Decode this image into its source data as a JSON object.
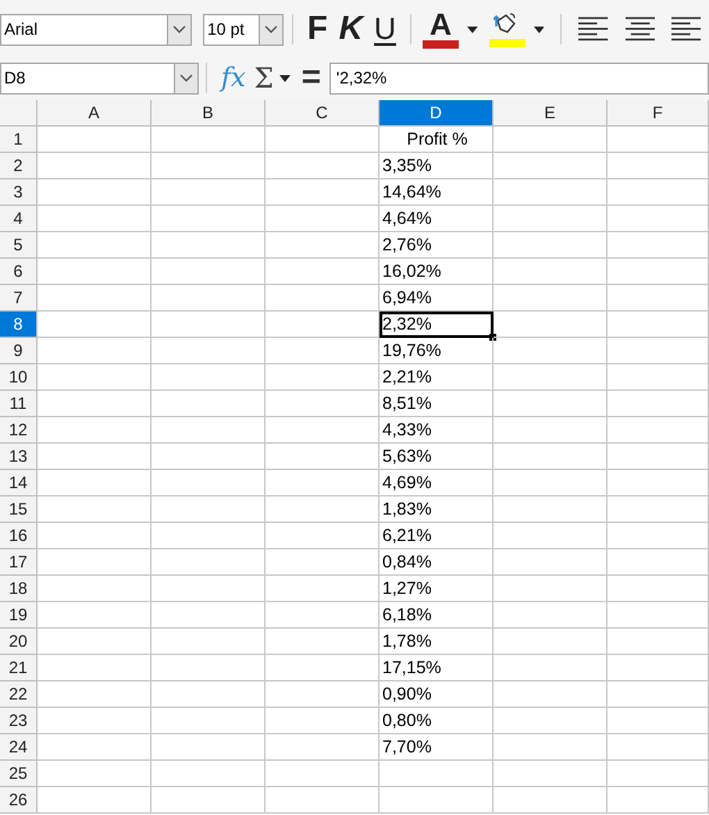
{
  "toolbar": {
    "font_name": "Arial",
    "font_size": "10 pt",
    "bold": "F",
    "italic": "K",
    "underline": "U",
    "font_color": "A"
  },
  "formula_bar": {
    "name_box": "D8",
    "function_wizard": "fx",
    "sum": "Σ",
    "equals": "=",
    "value": "'2,32%"
  },
  "columns": [
    {
      "label": "A",
      "selected": false
    },
    {
      "label": "B",
      "selected": false
    },
    {
      "label": "C",
      "selected": false
    },
    {
      "label": "D",
      "selected": true
    },
    {
      "label": "E",
      "selected": false
    },
    {
      "label": "F",
      "selected": false
    }
  ],
  "rows": [
    {
      "number": "1",
      "selected": false,
      "column_d": "Profit %"
    },
    {
      "number": "2",
      "selected": false,
      "column_d": "3,35%"
    },
    {
      "number": "3",
      "selected": false,
      "column_d": "14,64%"
    },
    {
      "number": "4",
      "selected": false,
      "column_d": "4,64%"
    },
    {
      "number": "5",
      "selected": false,
      "column_d": "2,76%"
    },
    {
      "number": "6",
      "selected": false,
      "column_d": "16,02%"
    },
    {
      "number": "7",
      "selected": false,
      "column_d": "6,94%"
    },
    {
      "number": "8",
      "selected": true,
      "column_d": "2,32%"
    },
    {
      "number": "9",
      "selected": false,
      "column_d": "19,76%"
    },
    {
      "number": "10",
      "selected": false,
      "column_d": "2,21%"
    },
    {
      "number": "11",
      "selected": false,
      "column_d": "8,51%"
    },
    {
      "number": "12",
      "selected": false,
      "column_d": "4,33%"
    },
    {
      "number": "13",
      "selected": false,
      "column_d": "5,63%"
    },
    {
      "number": "14",
      "selected": false,
      "column_d": "4,69%"
    },
    {
      "number": "15",
      "selected": false,
      "column_d": "1,83%"
    },
    {
      "number": "16",
      "selected": false,
      "column_d": "6,21%"
    },
    {
      "number": "17",
      "selected": false,
      "column_d": "0,84%"
    },
    {
      "number": "18",
      "selected": false,
      "column_d": "1,27%"
    },
    {
      "number": "19",
      "selected": false,
      "column_d": "6,18%"
    },
    {
      "number": "20",
      "selected": false,
      "column_d": "1,78%"
    },
    {
      "number": "21",
      "selected": false,
      "column_d": "17,15%"
    },
    {
      "number": "22",
      "selected": false,
      "column_d": "0,90%"
    },
    {
      "number": "23",
      "selected": false,
      "column_d": "0,80%"
    },
    {
      "number": "24",
      "selected": false,
      "column_d": "7,70%"
    },
    {
      "number": "25",
      "selected": false
    },
    {
      "number": "26",
      "selected": false
    }
  ]
}
